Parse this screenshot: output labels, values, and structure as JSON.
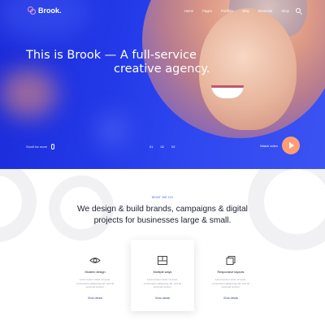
{
  "nav": {
    "logo": "Brook.",
    "menu": [
      "Home",
      "Pages",
      "Portfolio",
      "Blog",
      "Elements",
      "Shop"
    ]
  },
  "hero": {
    "line1": "This is Brook — A full-service",
    "line2": "creative agency.",
    "scroll_label": "Scroll for more",
    "pages": [
      "01",
      "02",
      "03"
    ],
    "watch_label": "Watch video"
  },
  "section": {
    "eyebrow": "WHAT WE DO",
    "heading_line1": "We design & build brands, campaigns & digital",
    "heading_line2": "projects for businesses large & small."
  },
  "cards": [
    {
      "title": "Modern design",
      "desc": "Lorem ipsum dolor sit amet, consectetur adipiscing elit, sed do eiusmod tempor.",
      "more": "Show details"
    },
    {
      "title": "Multiple ways",
      "desc": "Lorem ipsum dolor sit amet, consectetur adipiscing elit, sed do eiusmod tempor.",
      "more": "Show details"
    },
    {
      "title": "Responsive layouts",
      "desc": "Lorem ipsum dolor sit amet, consectetur adipiscing elit, sed do eiusmod tempor.",
      "more": "Show details"
    }
  ],
  "colors": {
    "accent": "#3a57f3",
    "play": "#ff9d73"
  }
}
